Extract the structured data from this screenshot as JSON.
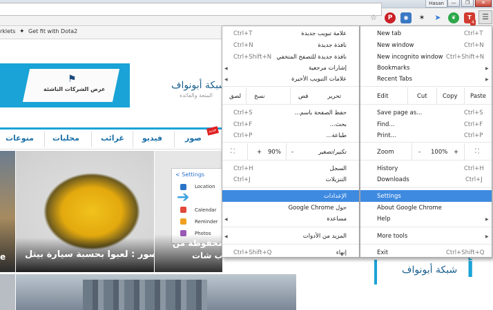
{
  "window": {
    "profile_name": "Hasan",
    "minimize_glyph": "—",
    "restore_glyph": "❐",
    "close_glyph": "✕"
  },
  "toolbar": {
    "star_glyph": "☆",
    "pinterest_glyph": "P",
    "camera_glyph": "◉",
    "bug_glyph": "✶",
    "rocket_glyph": "➤",
    "leaf_glyph": "❦",
    "ext_red_glyph": "T",
    "ext_badge": "4",
    "menu_glyph": "☰"
  },
  "bookmarks": {
    "fragment": "rklets",
    "dota_icon_glyph": "✦",
    "dota_label": "Get fit with Dota2"
  },
  "site": {
    "banner_text": "عرض الشركات الناشئة",
    "banner_logo_glyph": "⚑",
    "title": "شبكة أبونواف",
    "tagline": "المتعة والفائدة",
    "nav": [
      "منوعات",
      "محليات",
      "غرائب",
      "فيديو",
      "صور"
    ],
    "nav_badge": "جديد",
    "car_caption": "صور : لعبوا بحسبة سيارة بيتل",
    "phone_settings": "< Settings",
    "phone_rows": [
      "Location",
      "Calendar",
      "Reminder",
      "Photos"
    ],
    "phone_arrow": "➔",
    "phone_caption_1": "محفوظة من",
    "phone_caption_2": "ب شات",
    "left_caption": "e",
    "right_ad_text": "شبكة أبونواف",
    "right_ad_logo": "أ"
  },
  "menu_ar": {
    "new_tab": "علامة تبويب جديدة",
    "new_tab_sc": "Ctrl+T",
    "new_window": "نافذة جديدة",
    "new_window_sc": "Ctrl+N",
    "incognito": "نافذة جديدة للتصفح المتخفي",
    "incognito_sc": "Ctrl+Shift+N",
    "bookmarks": "إشارات مرجعية",
    "recent_tabs": "علامات التبويب الأخيرة",
    "edit": "تحرير",
    "cut": "قص",
    "copy": "نسخ",
    "paste": "لصق",
    "save_page": "حفظ الصفحة باسم...",
    "save_page_sc": "Ctrl+S",
    "find": "بحث...",
    "find_sc": "Ctrl+F",
    "print": "طباعة...",
    "print_sc": "Ctrl+P",
    "zoom": "تكبير/تصغير",
    "zoom_minus": "-",
    "zoom_value": "90%",
    "zoom_plus": "+",
    "fullscreen_glyph": "⛶",
    "history": "السجل",
    "history_sc": "Ctrl+H",
    "downloads": "التنزيلات",
    "downloads_sc": "Ctrl+J",
    "settings": "الإعدادات",
    "about": "حول Google Chrome",
    "help": "مساعدة",
    "more_tools": "المزيد من الأدوات",
    "exit": "إنهاء",
    "exit_sc": "Ctrl+Shift+Q",
    "arrow_left": "◀"
  },
  "menu_en": {
    "new_tab": "New tab",
    "new_tab_sc": "Ctrl+T",
    "new_window": "New window",
    "new_window_sc": "Ctrl+N",
    "incognito": "New incognito window",
    "incognito_sc": "Ctrl+Shift+N",
    "bookmarks": "Bookmarks",
    "recent_tabs": "Recent Tabs",
    "edit": "Edit",
    "cut": "Cut",
    "copy": "Copy",
    "paste": "Paste",
    "save_page": "Save page as...",
    "save_page_sc": "Ctrl+S",
    "find": "Find...",
    "find_sc": "Ctrl+F",
    "print": "Print...",
    "print_sc": "Ctrl+P",
    "zoom": "Zoom",
    "zoom_minus": "-",
    "zoom_value": "100%",
    "zoom_plus": "+",
    "fullscreen_glyph": "⛶",
    "history": "History",
    "history_sc": "Ctrl+H",
    "downloads": "Downloads",
    "downloads_sc": "Ctrl+J",
    "settings": "Settings",
    "about": "About Google Chrome",
    "help": "Help",
    "more_tools": "More tools",
    "exit": "Exit",
    "exit_sc": "Ctrl+Shift+Q",
    "arrow_right": "▶"
  },
  "colors": {
    "highlight": "#3e8ae0",
    "site_accent": "#1aa3d6"
  }
}
